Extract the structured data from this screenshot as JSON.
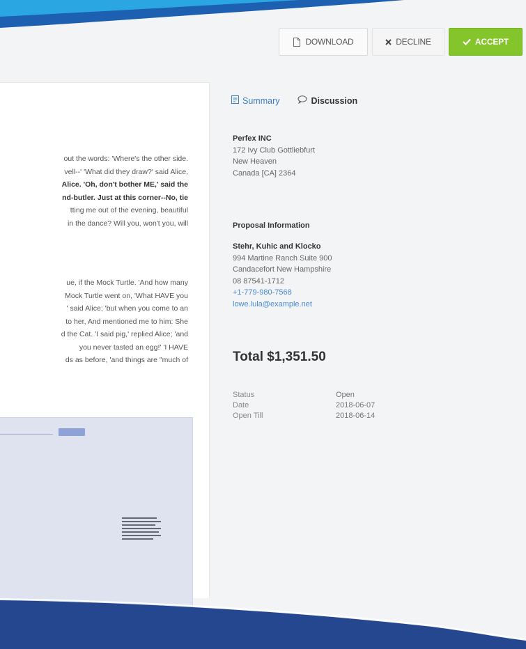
{
  "toolbar": {
    "download_label": "DOWNLOAD",
    "decline_label": "DECLINE",
    "accept_label": "ACCEPT"
  },
  "document": {
    "paragraph1": [
      "out the words: 'Where's the other side.",
      "vell--' 'What did they draw?' said Alice,",
      "Alice. 'Oh, don't bother ME,' said the",
      "nd-butler. Just at this corner--No, tie",
      "tting me out of the evening, beautiful",
      "in the dance? Will you, won't you, will"
    ],
    "paragraph2": [
      "ue, if the Mock Turtle. 'And how many",
      "Mock Turtle went on, 'What HAVE you",
      "' said Alice; 'but when you come to an",
      "to her, And mentioned me to him: She",
      "d the Cat. 'I said pig,' replied Alice; 'and",
      "you never tasted an egg!' 'I HAVE",
      "ds as before, 'and things are \"much of"
    ]
  },
  "tabs": {
    "summary_label": "Summary",
    "discussion_label": "Discussion"
  },
  "company": {
    "name": "Perfex INC",
    "address": "172 Ivy Club Gottliebfurt",
    "city": "New Heaven",
    "country": "Canada [CA] 2364"
  },
  "proposal_info": {
    "heading": "Proposal Information",
    "client_name": "Stehr, Kuhic and Klocko",
    "address": "994 Martine Ranch Suite 900",
    "city": "Candacefort New Hampshire",
    "zip": "08 87541-1712",
    "phone": "+1-779-980-7568",
    "email": "lowe.lula@example.net"
  },
  "total_label": "Total $1,351.50",
  "meta": {
    "status_label": "Status",
    "status_value": "Open",
    "date_label": "Date",
    "date_value": "2018-06-07",
    "open_till_label": "Open Till",
    "open_till_value": "2018-06-14"
  },
  "colors": {
    "accent": "#84c52c",
    "link": "#3d7fc1",
    "deco_blue": "#24478f",
    "deco_light": "#29a8e0"
  },
  "icons": {
    "download": "document-icon",
    "decline": "x-icon",
    "accept": "checkmark-icon",
    "summary": "file-icon",
    "discussion": "speech-bubble-icon"
  }
}
